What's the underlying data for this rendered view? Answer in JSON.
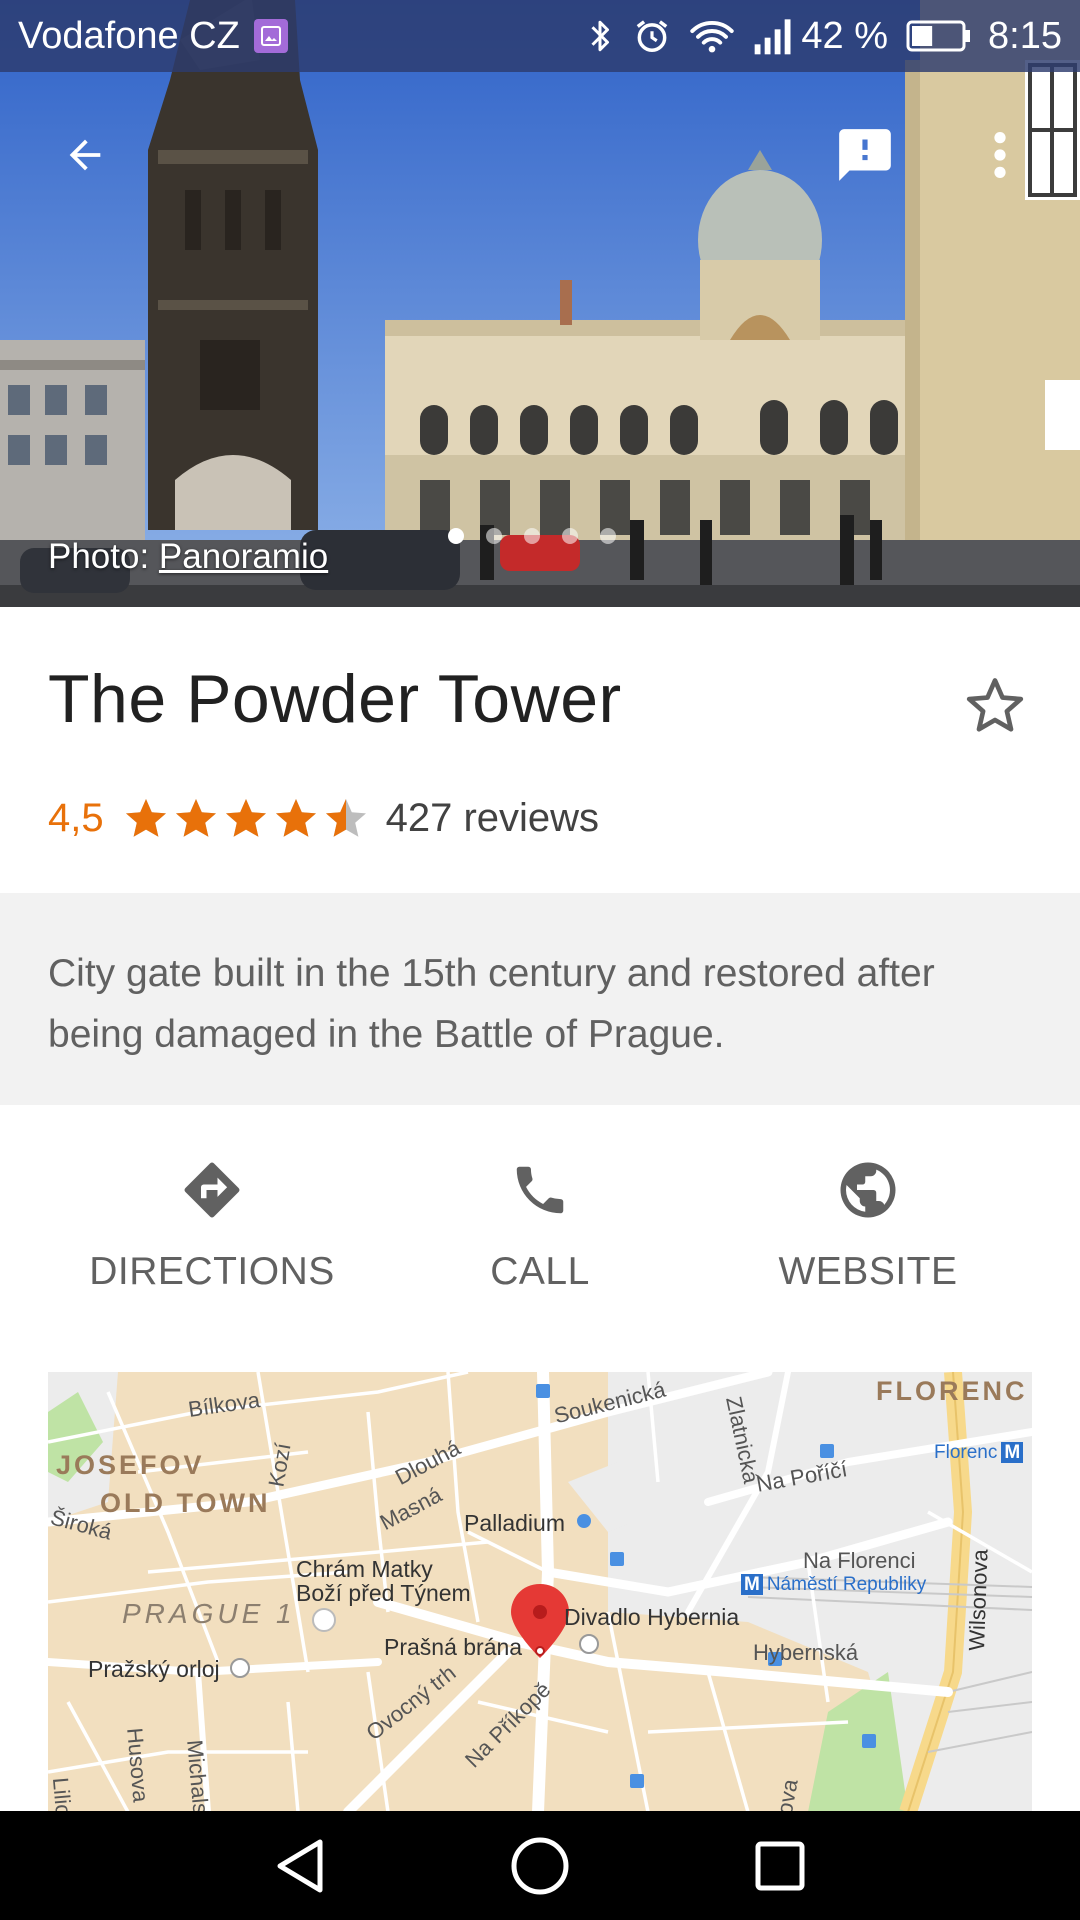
{
  "status_bar": {
    "carrier": "Vodafone CZ",
    "battery": "42 %",
    "time": "8:15",
    "icons": [
      "gallery-notification-icon",
      "bluetooth-icon",
      "alarm-icon",
      "wifi-icon",
      "signal-icon",
      "battery-icon"
    ]
  },
  "toolbar": {
    "icons": [
      "back-arrow-icon",
      "feedback-icon",
      "more-vert-icon"
    ]
  },
  "photo": {
    "credit_prefix": "Photo: ",
    "credit_link": "Panoramio",
    "page_count": 5,
    "active_page": 0
  },
  "place": {
    "title": "The Powder Tower",
    "rating": "4,5",
    "rating_value": 4.5,
    "rating_max": 5,
    "reviews": "427 reviews",
    "description": "City gate built in the 15th century and restored after being damaged in the Battle of Prague."
  },
  "actions": [
    {
      "label": "DIRECTIONS",
      "icon": "directions-icon"
    },
    {
      "label": "CALL",
      "icon": "phone-icon"
    },
    {
      "label": "WEBSITE",
      "icon": "globe-icon"
    }
  ],
  "map": {
    "streets": {
      "bilkova": "Bílkova",
      "soukenicka": "Soukenická",
      "zlatnicka": "Zlatnická",
      "na_porici": "Na Poříčí",
      "dlouha": "Dlouhá",
      "kozi": "Kozí",
      "masna": "Masná",
      "siroka": "Široká",
      "ovocny_trh": "Ovocný trh",
      "na_prikope": "Na Příkopě",
      "hybernska": "Hybernská",
      "na_florenci": "Na Florenci",
      "wilsonova": "Wilsonova",
      "husova": "Husova",
      "michalska": "Michals",
      "liliova": "Lilio",
      "ova": "ova"
    },
    "districts": {
      "florenc": "FLORENC",
      "josefov": "JOSEFOV",
      "old_town": "OLD TOWN",
      "prague1": "PRAGUE 1"
    },
    "places": {
      "palladium": "Palladium",
      "chram_line1": "Chrám Matky",
      "chram_line2": "Boží před Týnem",
      "prasna_brana": "Prašná brána",
      "divadlo": "Divadlo Hybernia",
      "orloj": "Pražský orloj",
      "namesti": "Náměstí Republiky",
      "florenc_metro": "Florenc"
    },
    "metro_badge": "M"
  },
  "colors": {
    "accent_orange": "#e8710a",
    "pin_red": "#e53935",
    "map_land": "#f2dfbf",
    "map_road": "#ffffff",
    "map_park": "#bfe3a5",
    "map_highway": "#f7d98b"
  }
}
